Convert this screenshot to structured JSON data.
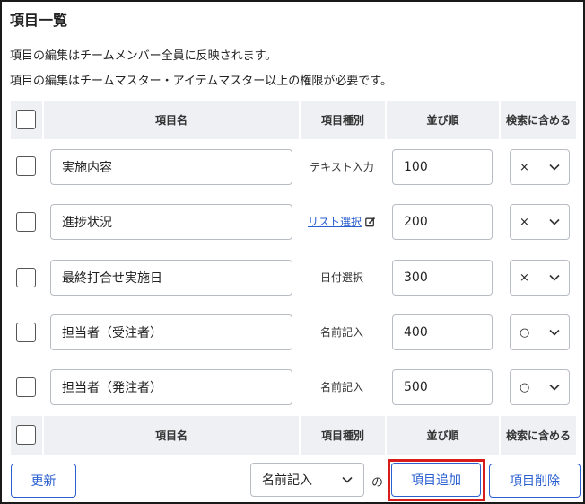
{
  "title": "項目一覧",
  "descriptions": [
    "項目の編集はチームメンバー全員に反映されます。",
    "項目の編集はチームマスター・アイテムマスター以上の権限が必要です。"
  ],
  "columns": {
    "name": "項目名",
    "type": "項目種別",
    "order": "並び順",
    "searchable": "検索に含める"
  },
  "rows": [
    {
      "name": "実施内容",
      "type": "テキスト入力",
      "type_is_link": false,
      "order": "100",
      "searchable": "×"
    },
    {
      "name": "進捗状況",
      "type": "リスト選択",
      "type_is_link": true,
      "order": "200",
      "searchable": "×"
    },
    {
      "name": "最終打合せ実施日",
      "type": "日付選択",
      "type_is_link": false,
      "order": "300",
      "searchable": "×"
    },
    {
      "name": "担当者（受注者）",
      "type": "名前記入",
      "type_is_link": false,
      "order": "400",
      "searchable": "○"
    },
    {
      "name": "担当者（発注者）",
      "type": "名前記入",
      "type_is_link": false,
      "order": "500",
      "searchable": "○"
    }
  ],
  "footer": {
    "update_label": "更新",
    "type_select_value": "名前記入",
    "no_label": "の",
    "add_label": "項目追加",
    "delete_label": "項目削除"
  },
  "colors": {
    "accent": "#2a5fd0",
    "highlight": "#d81b1b",
    "header_bg": "#eef0f4"
  }
}
